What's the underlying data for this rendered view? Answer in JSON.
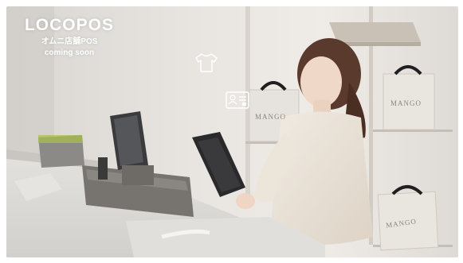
{
  "brand": {
    "title": "LOCOPOS",
    "subtitle": "オムニ店舗POS",
    "tagline": "coming soon"
  },
  "scene": {
    "bag_labels": [
      "MANGO",
      "MANGO",
      "MANGO"
    ]
  },
  "icons": {
    "overlay_1": "tshirt-icon",
    "overlay_2": "id-card-icon"
  },
  "colors": {
    "background": "#ffffff",
    "wall": "#ece8e3",
    "text": "#ffffff"
  }
}
